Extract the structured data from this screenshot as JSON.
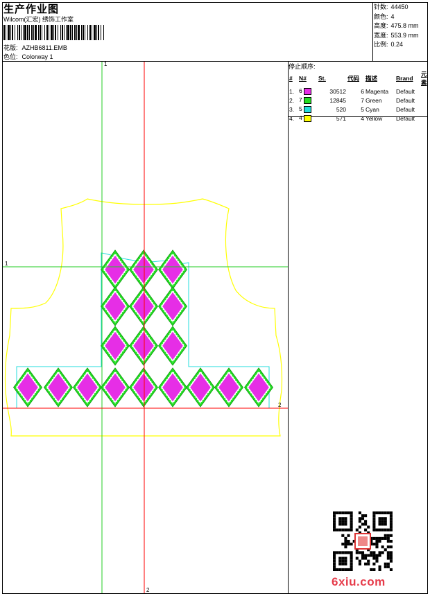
{
  "header": {
    "title": "生产作业图",
    "company": "Wilcom(汇宏) 绣饰工作室",
    "design_label": "花版:",
    "design_value": "AZHB6811.EMB",
    "colorway_label": "色位:",
    "colorway_value": "Colorway 1"
  },
  "stats": [
    {
      "label": "针数:",
      "value": "44450"
    },
    {
      "label": "颜色:",
      "value": "4"
    },
    {
      "label": "高度:",
      "value": "475.8 mm"
    },
    {
      "label": "宽度:",
      "value": "553.9 mm"
    },
    {
      "label": "比例:",
      "value": "0.24"
    }
  ],
  "stop_sequence": {
    "heading": "停止顺序:",
    "columns": [
      "#",
      "N#",
      "St.",
      "代码",
      "描述",
      "Brand",
      "元素"
    ],
    "rows": [
      {
        "idx": "1.",
        "n": "6",
        "color": "#e62ee6",
        "st": "30512",
        "code": "6",
        "desc": "Magenta",
        "brand": "Default"
      },
      {
        "idx": "2.",
        "n": "7",
        "color": "#22dd22",
        "st": "12845",
        "code": "7",
        "desc": "Green",
        "brand": "Default"
      },
      {
        "idx": "3.",
        "n": "5",
        "color": "#22dddd",
        "st": "520",
        "code": "5",
        "desc": "Cyan",
        "brand": "Default"
      },
      {
        "idx": "4.",
        "n": "4",
        "color": "#ffff00",
        "st": "571",
        "code": "4",
        "desc": "Yellow",
        "brand": "Default"
      }
    ]
  },
  "axes": {
    "top": "1",
    "left": "1",
    "right": "2",
    "bottom": "2"
  },
  "colors": {
    "magenta": "#e62ee6",
    "green": "#22dd22",
    "cyan": "#22dddd",
    "yellow": "#ffff00",
    "guide_red": "#ff0000",
    "guide_green": "#22cc22"
  },
  "watermark": "6xiu.com"
}
